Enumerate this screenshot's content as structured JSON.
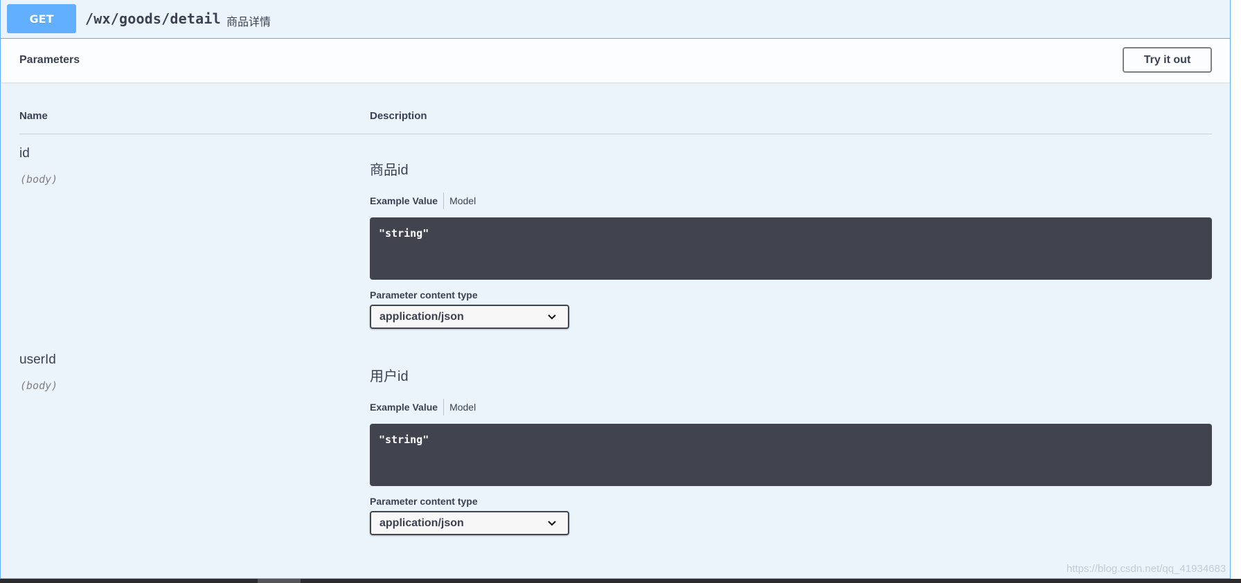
{
  "summary": {
    "method": "GET",
    "path": "/wx/goods/detail",
    "description": "商品详情"
  },
  "section": {
    "title": "Parameters",
    "try_it_out": "Try it out"
  },
  "table": {
    "col_name": "Name",
    "col_description": "Description"
  },
  "parameters": [
    {
      "name": "id",
      "in": "(body)",
      "description": "商品id",
      "tab_example": "Example Value",
      "tab_model": "Model",
      "example": "\"string\"",
      "content_type_label": "Parameter content type",
      "content_type": "application/json"
    },
    {
      "name": "userId",
      "in": "(body)",
      "description": "用户id",
      "tab_example": "Example Value",
      "tab_model": "Model",
      "example": "\"string\"",
      "content_type_label": "Parameter content type",
      "content_type": "application/json"
    }
  ],
  "watermark": "https://blog.csdn.net/qq_41934683",
  "colors": {
    "get_accent": "#61affe",
    "block_bg": "#ebf3fb",
    "code_bg": "#41444e"
  },
  "icons": {
    "select_arrow": "chevron-down-icon"
  }
}
